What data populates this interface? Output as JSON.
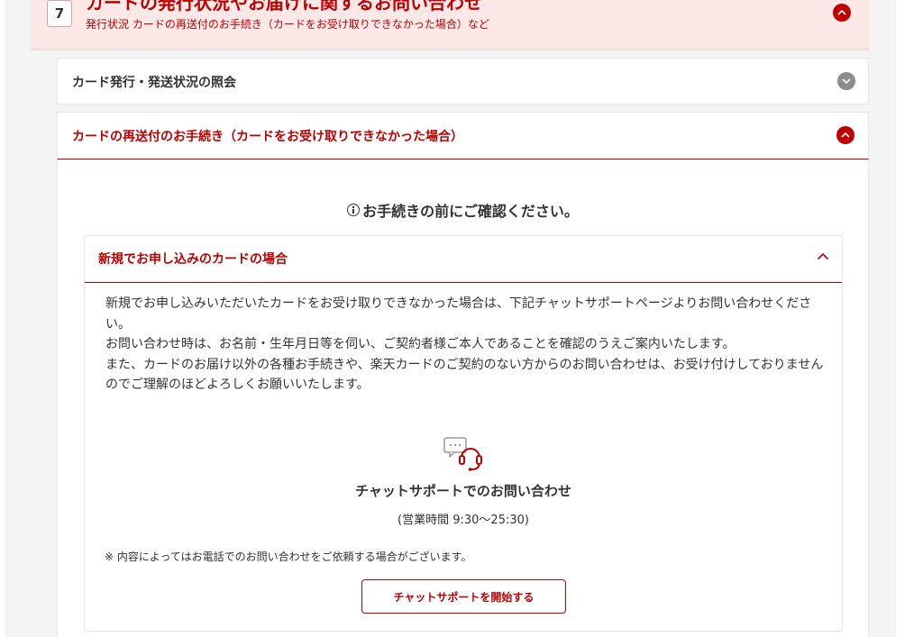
{
  "category": {
    "number": "7",
    "title": "カードの発行状況やお届けに関するお問い合わせ",
    "subtitle": "発行状況  カードの再送付のお手続き（カードをお受け取りできなかった場合）など",
    "toggle_icon": "chevron-up-icon"
  },
  "accordion_items": [
    {
      "label": "カード発行・発送状況の照会",
      "expanded": false,
      "icon": "chevron-down-icon"
    },
    {
      "label": "カードの再送付のお手続き（カードをお受け取りできなかった場合）",
      "expanded": true,
      "icon": "chevron-up-icon"
    }
  ],
  "notice": {
    "text": "お手続きの前にご確認ください。",
    "icon": "info-circle-icon"
  },
  "section": {
    "title": "新規でお申し込みのカードの場合",
    "toggle_icon": "chevron-up-icon",
    "paragraphs": [
      "新規でお申し込みいただいたカードをお受け取りできなかった場合は、下記チャットサポートページよりお問い合わせください。",
      "お問い合わせ時は、お名前・生年月日等を伺い、ご契約者様ご本人であることを確認のうえご案内いたします。",
      "また、カードのお届け以外の各種お手続きや、楽天カードのご契約のない方からのお問い合わせは、お受け付けしておりませんのでご理解のほどよろしくお願いいたします。"
    ]
  },
  "chat": {
    "icon": "chat-support-headset-icon",
    "title": "チャットサポートでのお問い合わせ",
    "hours": "(営業時間 9:30〜25:30)",
    "note": "※  内容によってはお電話でのお問い合わせをご依頼する場合がございます。",
    "button_label": "チャットサポートを開始する"
  },
  "colors": {
    "accent": "#bf0000",
    "header_bg": "#fde8e8",
    "panel_bg": "#f4f4f4",
    "muted_icon": "#8c8c8c"
  }
}
